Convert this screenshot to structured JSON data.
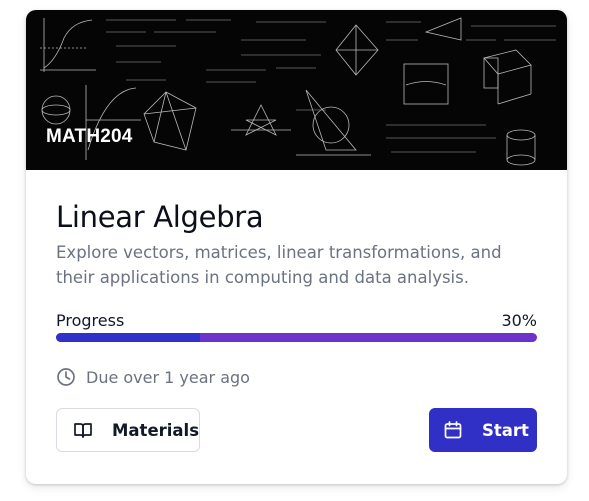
{
  "course": {
    "code": "MATH204",
    "title": "Linear Algebra",
    "description": "Explore vectors, matrices, linear transformations, and their applications in computing and data analysis.",
    "progress_label": "Progress",
    "progress_text": "30%",
    "progress_fraction": 0.3,
    "due_text": "Due over 1 year ago"
  },
  "buttons": {
    "materials_label": "Materials",
    "start_label": "Start"
  },
  "icons": {
    "due": "clock-icon",
    "materials": "book-open-icon",
    "start": "calendar-icon"
  },
  "colors": {
    "progress_fill": "#3131c9",
    "progress_track": "#6d32c9",
    "primary_button": "#3130c6",
    "banner_background": "#050505"
  }
}
